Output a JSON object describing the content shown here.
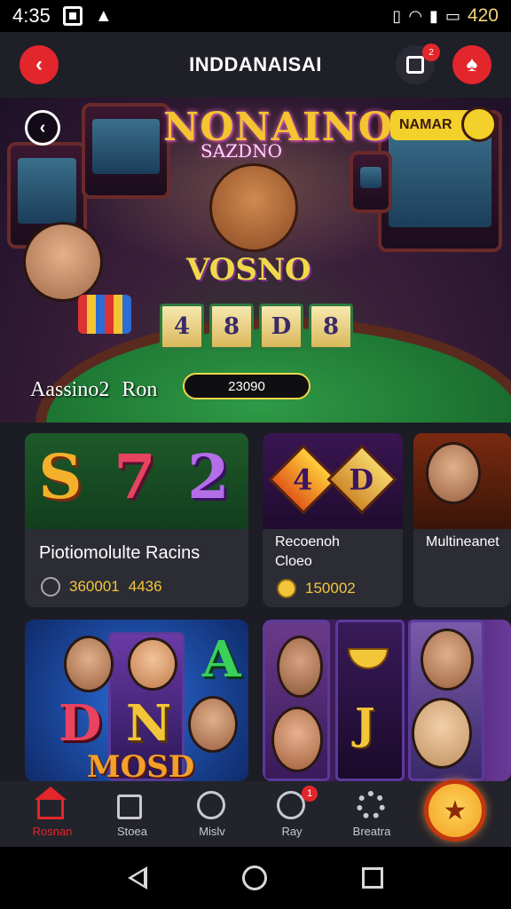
{
  "status_bar": {
    "time": "4:35",
    "battery_text": "420"
  },
  "header": {
    "title": "INDDANAISAI",
    "back_glyph": "‹",
    "message_badge": "2",
    "profile_glyph": "♠"
  },
  "hero": {
    "logo": "NONAINO",
    "subtitle": "SAZDNO",
    "board_text": "VOSNO",
    "board_cards": [
      "4",
      "8",
      "D",
      "8"
    ],
    "slot_banner": "NAMAR",
    "caption_left": "Aassino2",
    "caption_right": "Ron",
    "pill_value": "23090",
    "back_glyph": "‹"
  },
  "cards": [
    {
      "letters": [
        "S",
        "7",
        "2"
      ],
      "title": "Piotiomolulte Racins",
      "meta1": "360001",
      "meta2": "4436"
    },
    {
      "letters": [
        "4",
        "D"
      ],
      "title_line1": "Recoenoh",
      "title_line2": "Cloeo",
      "meta1": "150002"
    },
    {
      "title": "Multineanet"
    }
  ],
  "row2": {
    "left_letters": [
      "A",
      "D",
      "N"
    ],
    "left_bottom": "MOSD",
    "right_letters": [
      "J"
    ]
  },
  "bottom_nav": {
    "items": [
      {
        "label": "Rosnan",
        "active": true
      },
      {
        "label": "Stoea",
        "active": false
      },
      {
        "label": "Mislv",
        "active": false
      },
      {
        "label": "Ray",
        "active": false,
        "badge": "1"
      },
      {
        "label": "Breatra",
        "active": false
      }
    ],
    "fab_glyph": "★"
  },
  "colors": {
    "accent_red": "#e3262c",
    "gold": "#f3c63a",
    "felt_green": "#1f7a35"
  }
}
